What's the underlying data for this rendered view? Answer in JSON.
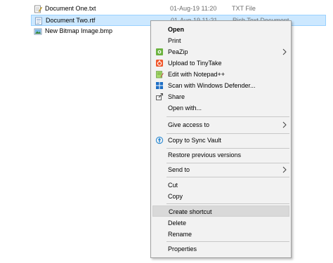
{
  "files": [
    {
      "name": "Document One.txt",
      "date": "01-Aug-19 11:20",
      "type": "TXT File",
      "icon": "text-file-icon"
    },
    {
      "name": "Document Two.rtf",
      "date": "01-Aug-19 11:21",
      "type": "Rich Text Document",
      "icon": "rtf-file-icon",
      "selected": true
    },
    {
      "name": "New Bitmap Image.bmp",
      "date": "",
      "type": "",
      "icon": "bitmap-file-icon"
    }
  ],
  "context_menu": {
    "items": [
      {
        "label": "Open",
        "bold": true
      },
      {
        "label": "Print"
      },
      {
        "label": "PeaZip",
        "icon": "peazip-icon",
        "submenu": true
      },
      {
        "label": "Upload to TinyTake",
        "icon": "tinytake-icon"
      },
      {
        "label": "Edit with Notepad++",
        "icon": "notepadpp-icon"
      },
      {
        "label": "Scan with Windows Defender...",
        "icon": "defender-icon"
      },
      {
        "label": "Share",
        "icon": "share-icon"
      },
      {
        "label": "Open with..."
      },
      {
        "label": "Give access to",
        "submenu": true
      },
      {
        "label": "Copy to Sync Vault",
        "icon": "sync-vault-icon"
      },
      {
        "label": "Restore previous versions"
      },
      {
        "label": "Send to",
        "submenu": true
      },
      {
        "label": "Cut"
      },
      {
        "label": "Copy"
      },
      {
        "label": "Create shortcut",
        "highlighted": true
      },
      {
        "label": "Delete"
      },
      {
        "label": "Rename"
      },
      {
        "label": "Properties"
      }
    ]
  },
  "colors": {
    "selection_bg": "#cce8ff",
    "menu_bg": "#f2f2f2",
    "menu_hover": "#d9d9d9"
  }
}
